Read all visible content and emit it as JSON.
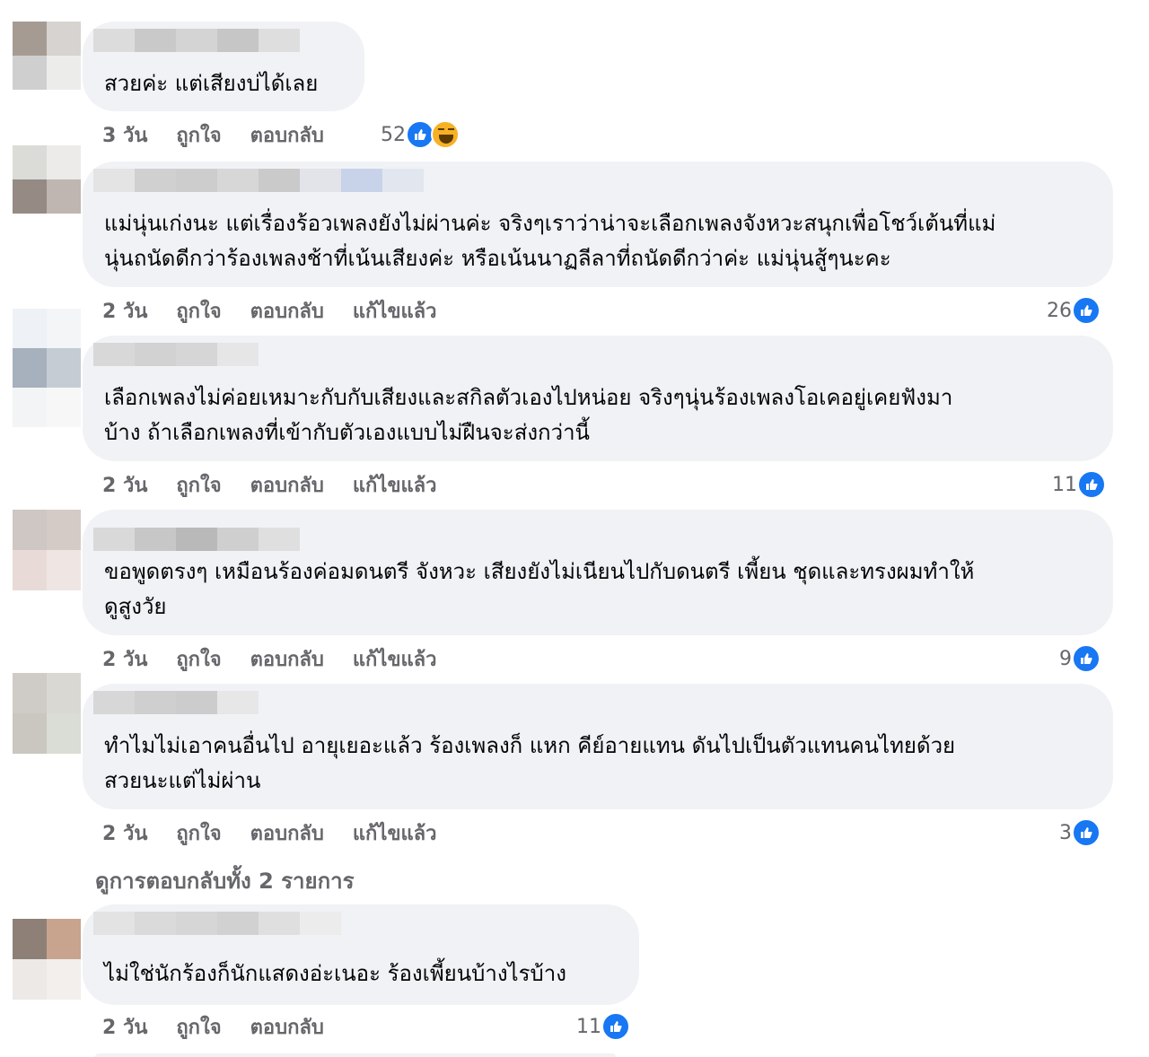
{
  "comments": [
    {
      "text": "สวยค่ะ แต่เสียงบ่ได้เลย",
      "time": "3 วัน",
      "like_label": "ถูกใจ",
      "reply_label": "ตอบกลับ",
      "reaction_count": "52",
      "reactions": [
        "like-icon",
        "haha-icon"
      ]
    },
    {
      "text": "แม่นุ่นเก่งนะ แต่เรื่องร้อวเพลงยังไม่ผ่านค่ะ จริงๆเราว่าน่าจะเลือกเพลงจังหวะสนุกเพื่อโชว์เต้นที่แม่\nนุ่นถนัดดีกว่าร้องเพลงช้าที่เน้นเสียงค่ะ หรือเน้นนาฏลีลาที่ถนัดดีกว่าค่ะ แม่นุ่นสู้ๆนะคะ",
      "time": "2 วัน",
      "like_label": "ถูกใจ",
      "reply_label": "ตอบกลับ",
      "edited_label": "แก้ไขแล้ว",
      "reaction_count": "26"
    },
    {
      "text": "เลือกเพลงไม่ค่อยเหมาะกับกับเสียงและสกิลตัวเองไปหน่อย จริงๆนุ่นร้องเพลงโอเคอยู่เคยฟังมา\nบ้าง ถ้าเลือกเพลงที่เข้ากับตัวเองแบบไม่ฝืนจะส่งกว่านี้",
      "time": "2 วัน",
      "like_label": "ถูกใจ",
      "reply_label": "ตอบกลับ",
      "edited_label": "แก้ไขแล้ว",
      "reaction_count": "11"
    },
    {
      "text": "ขอพูดตรงๆ เหมือนร้องค่อมดนตรี จังหวะ เสียงยังไม่เนียนไปกับดนตรี เพี้ยน ชุดและทรงผมทำให้\nดูสูงวัย",
      "time": "2 วัน",
      "like_label": "ถูกใจ",
      "reply_label": "ตอบกลับ",
      "edited_label": "แก้ไขแล้ว",
      "reaction_count": "9"
    },
    {
      "text": "ทำไมไม่เอาคนอื่นไป อายุเยอะแล้ว ร้องเพลงก็ แหก คีย์อายแทน ดันไปเป็นตัวแทนคนไทยด้วย\nสวยนะแต่ไม่ผ่าน",
      "time": "2 วัน",
      "like_label": "ถูกใจ",
      "reply_label": "ตอบกลับ",
      "edited_label": "แก้ไขแล้ว",
      "reaction_count": "3"
    },
    {
      "text": "ไม่ใช่นักร้องก็นักแสดงอ่ะเนอะ ร้องเพี้ยนบ้างไรบ้าง",
      "time": "2 วัน",
      "like_label": "ถูกใจ",
      "reply_label": "ตอบกลับ",
      "reaction_count": "11"
    }
  ],
  "view_replies_label": "ดูการตอบกลับทั้ง 2 รายการ",
  "colors": {
    "bubble": "#f0f2f5",
    "meta_text": "#65676b",
    "like_blue": "#1877f2",
    "haha_yellow": "#f7b125"
  }
}
